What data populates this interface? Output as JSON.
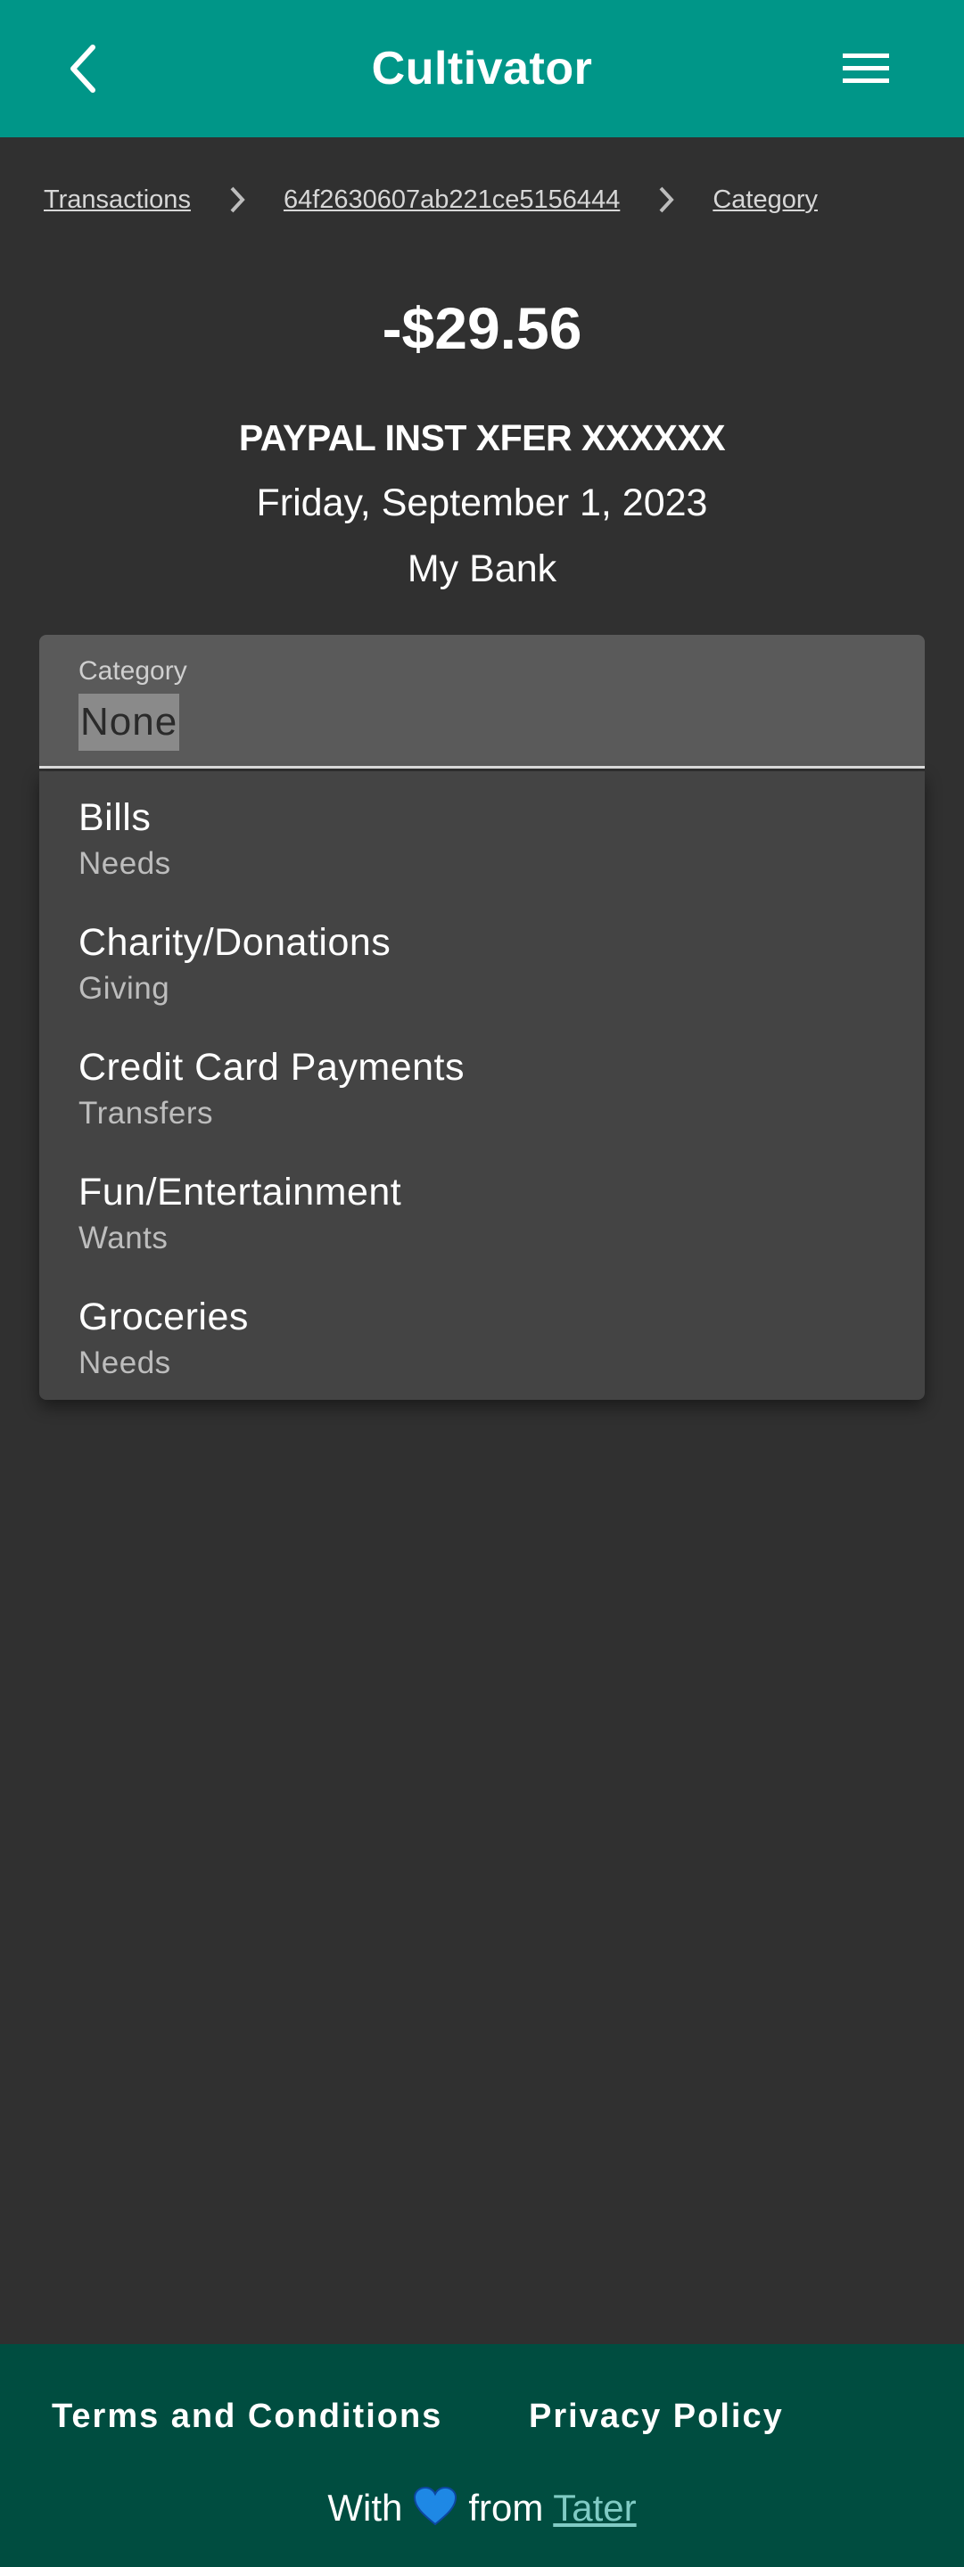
{
  "appbar": {
    "title": "Cultivator",
    "back_icon": "chevron-left-icon",
    "menu_icon": "hamburger-menu-icon"
  },
  "breadcrumb": {
    "items": [
      "Transactions",
      "64f2630607ab221ce5156444",
      "Category"
    ],
    "separator_icon": "chevron-right-icon"
  },
  "transaction": {
    "amount": "-$29.56",
    "description": "PAYPAL INST XFER XXXXXX",
    "date": "Friday, September 1, 2023",
    "account": "My Bank"
  },
  "category_select": {
    "label": "Category",
    "value": "None",
    "options": [
      {
        "name": "Bills",
        "group": "Needs"
      },
      {
        "name": "Charity/Donations",
        "group": "Giving"
      },
      {
        "name": "Credit Card Payments",
        "group": "Transfers"
      },
      {
        "name": "Fun/Entertainment",
        "group": "Wants"
      },
      {
        "name": "Groceries",
        "group": "Needs"
      }
    ]
  },
  "footer": {
    "terms": "Terms and Conditions",
    "privacy": "Privacy Policy",
    "credit_prefix": "With",
    "credit_middle": "from",
    "credit_link": "Tater",
    "heart_icon": "blue-heart-icon"
  },
  "colors": {
    "appbar": "#009688",
    "background": "#303030",
    "footer": "#004d40",
    "link_accent": "#80cbc4"
  }
}
